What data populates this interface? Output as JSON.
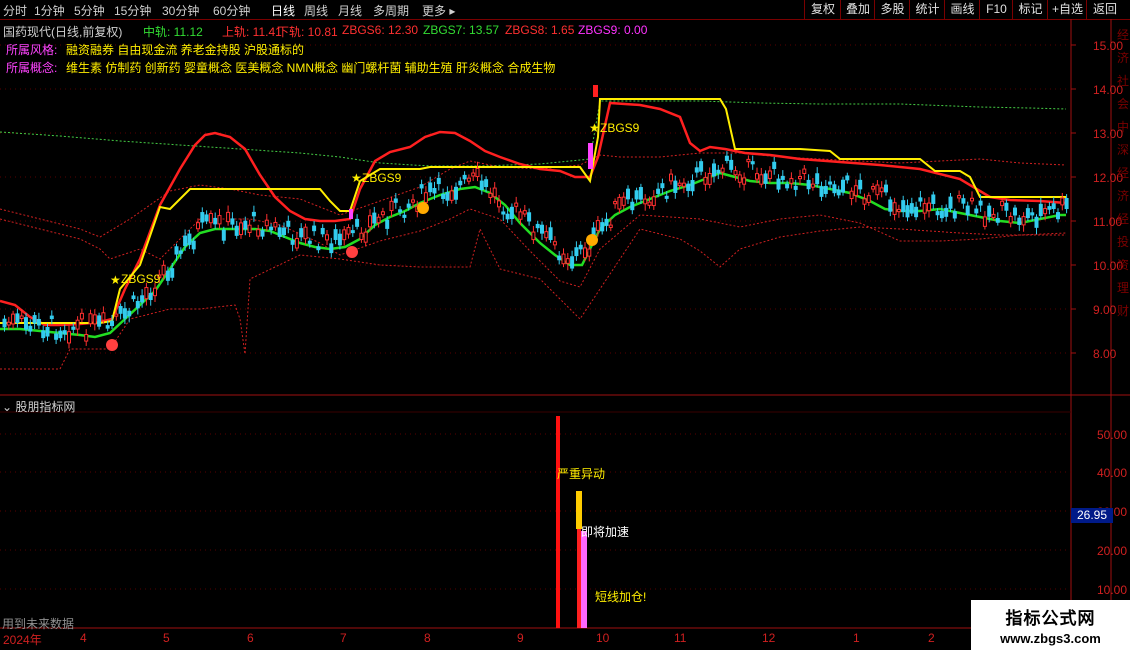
{
  "toolbar": {
    "periods": [
      "分时",
      "1分钟",
      "5分钟",
      "15分钟",
      "30分钟",
      "60分钟",
      "日线",
      "周线",
      "月线",
      "多周期",
      "更多 ▸"
    ],
    "active_period": "日线",
    "right_buttons": [
      "复权",
      "叠加",
      "多股",
      "统计",
      "画线",
      "F10",
      "标记",
      "+自选",
      "返回"
    ]
  },
  "chart_header": {
    "stock_title": "国药现代(日线,前复权)",
    "indicators": [
      {
        "text": "中轨: 11.12",
        "color": "#33dd33"
      },
      {
        "text": "上轨: 11.41",
        "color": "#ff3030"
      },
      {
        "text": "下轨: 10.81",
        "color": "#ff3030"
      },
      {
        "text": "ZBGS6: 12.30",
        "color": "#ff3030"
      },
      {
        "text": "ZBGS7: 13.57",
        "color": "#33dd33"
      },
      {
        "text": "ZBGS8: 1.65",
        "color": "#ff3030"
      },
      {
        "text": "ZBGS9: 0.00",
        "color": "#ff33ff"
      }
    ]
  },
  "tags": {
    "style_label": "所属风格:",
    "style_values": "融资融券 自由现金流 养老金持股 沪股通标的",
    "concept_label": "所属概念:",
    "concept_values": "维生素 仿制药 创新药 婴童概念 医美概念 NMN概念 幽门螺杆菌 辅助生殖 肝炎概念 合成生物"
  },
  "price_axis": [
    "15.00",
    "14.00",
    "13.00",
    "12.00",
    "11.00",
    "10.00",
    "9.00",
    "8.00"
  ],
  "chart_markers": [
    "ZBGS9",
    "ZBGS9",
    "ZBGS9"
  ],
  "sub_panel": {
    "title": "股朋指标网",
    "axis": [
      "50.00",
      "40.00",
      "30.00",
      "20.00",
      "10.00"
    ],
    "current_value": "26.95",
    "annotations": [
      "严重异动",
      "即将加速",
      "短线加仓!"
    ],
    "footer_note": "用到未来数据"
  },
  "time_axis": [
    "2024年",
    "4",
    "5",
    "6",
    "7",
    "8",
    "9",
    "10",
    "11",
    "12",
    "1",
    "2"
  ],
  "right_panel_text": "经济 社会 中 深 经 济 经 投 资 理 财",
  "watermark": {
    "title": "指标公式网",
    "url": "www.zbgs3.com"
  },
  "colors": {
    "upper_band": "#ff2020",
    "mid_line": "#22dd22",
    "resistance": "#ffee00",
    "dotted_mid": "#44cc44",
    "candle_up": "#ff3030",
    "candle_down": "#33ccee",
    "axis": "#d02020"
  }
}
